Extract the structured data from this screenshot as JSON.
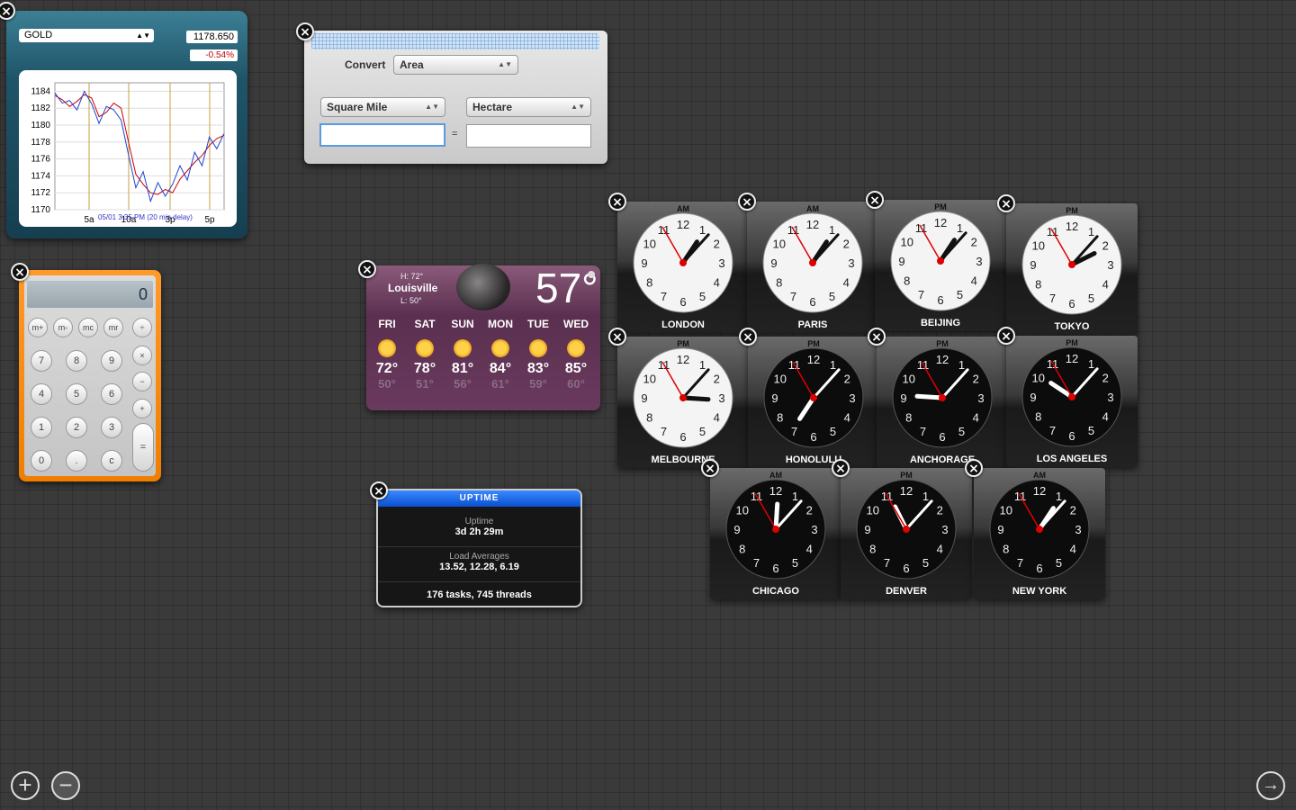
{
  "stocks": {
    "symbol": "GOLD",
    "price": "1178.650",
    "change": "-0.54%",
    "chart_data": {
      "type": "line",
      "y_ticks": [
        "1184",
        "1182",
        "1180",
        "1178",
        "1176",
        "1174",
        "1172",
        "1170"
      ],
      "x_ticks": [
        "5a",
        "10a",
        "3p",
        "5p"
      ],
      "footer": "05/01 3:35 PM (20 min delay)",
      "ylim": [
        1170,
        1185
      ],
      "series": [
        {
          "color": "#cc0000",
          "values": [
            1183.5,
            1183.0,
            1182.2,
            1182.8,
            1183.6,
            1183.2,
            1181.0,
            1181.5,
            1182.6,
            1182.0,
            1178.0,
            1174.2,
            1173.0,
            1172.0,
            1171.8,
            1172.4,
            1172.0,
            1173.6,
            1174.6,
            1175.6,
            1176.4,
            1177.6,
            1178.4,
            1178.8
          ]
        },
        {
          "color": "#2244cc",
          "values": [
            1183.8,
            1182.6,
            1182.9,
            1181.8,
            1184.0,
            1182.5,
            1180.2,
            1182.2,
            1181.8,
            1180.6,
            1176.5,
            1172.6,
            1174.5,
            1171.0,
            1173.2,
            1171.6,
            1173.0,
            1175.2,
            1173.5,
            1176.8,
            1175.2,
            1178.6,
            1177.2,
            1179.0
          ]
        }
      ]
    }
  },
  "converter": {
    "label": "Convert",
    "category": "Area",
    "from_unit": "Square Mile",
    "to_unit": "Hectare",
    "from_value": "",
    "to_value": "",
    "equals": "="
  },
  "calculator": {
    "display": "0",
    "memory_keys": [
      "m+",
      "m-",
      "mc",
      "mr"
    ],
    "op_keys": [
      "÷",
      "×",
      "−",
      "+"
    ],
    "digits": [
      [
        "7",
        "8",
        "9"
      ],
      [
        "4",
        "5",
        "6"
      ],
      [
        "1",
        "2",
        "3"
      ],
      [
        "0",
        ".",
        "c"
      ]
    ],
    "equals": "="
  },
  "weather": {
    "city": "Louisville",
    "high": "H: 72°",
    "low": "L: 50°",
    "temp": "57°",
    "days": [
      {
        "name": "FRI",
        "hi": "72°",
        "lo": "50°"
      },
      {
        "name": "SAT",
        "hi": "78°",
        "lo": "51°"
      },
      {
        "name": "SUN",
        "hi": "81°",
        "lo": "56°"
      },
      {
        "name": "MON",
        "hi": "84°",
        "lo": "61°"
      },
      {
        "name": "TUE",
        "hi": "83°",
        "lo": "59°"
      },
      {
        "name": "WED",
        "hi": "85°",
        "lo": "60°"
      }
    ]
  },
  "uptime": {
    "title": "UPTIME",
    "uptime_label": "Uptime",
    "uptime_value": "3d 2h 29m",
    "load_label": "Load Averages",
    "load_value": "13.52, 12.28, 6.19",
    "tasks": "176 tasks, 745 threads"
  },
  "clocks": [
    {
      "city": "LONDON",
      "ampm": "AM",
      "theme": "light",
      "h": 1,
      "m": 7,
      "s": 55
    },
    {
      "city": "PARIS",
      "ampm": "AM",
      "theme": "light",
      "h": 1,
      "m": 7,
      "s": 55
    },
    {
      "city": "BEIJING",
      "ampm": "PM",
      "theme": "light",
      "h": 1,
      "m": 7,
      "s": 55
    },
    {
      "city": "TOKYO",
      "ampm": "PM",
      "theme": "light",
      "h": 2,
      "m": 7,
      "s": 55
    },
    {
      "city": "MELBOURNE",
      "ampm": "PM",
      "theme": "light",
      "h": 3,
      "m": 7,
      "s": 55
    },
    {
      "city": "HONOLULU",
      "ampm": "PM",
      "theme": "dark",
      "h": 7,
      "m": 7,
      "s": 55
    },
    {
      "city": "ANCHORAGE",
      "ampm": "PM",
      "theme": "dark",
      "h": 9,
      "m": 7,
      "s": 55
    },
    {
      "city": "LOS ANGELES",
      "ampm": "PM",
      "theme": "dark",
      "h": 10,
      "m": 7,
      "s": 55
    },
    {
      "city": "CHICAGO",
      "ampm": "AM",
      "theme": "dark",
      "h": 12,
      "m": 7,
      "s": 55
    },
    {
      "city": "DENVER",
      "ampm": "PM",
      "theme": "dark",
      "h": 11,
      "m": 7,
      "s": 55
    },
    {
      "city": "NEW YORK",
      "ampm": "AM",
      "theme": "dark",
      "h": 1,
      "m": 7,
      "s": 55
    }
  ],
  "dock": {
    "add": "+",
    "remove": "−",
    "next": "→"
  }
}
